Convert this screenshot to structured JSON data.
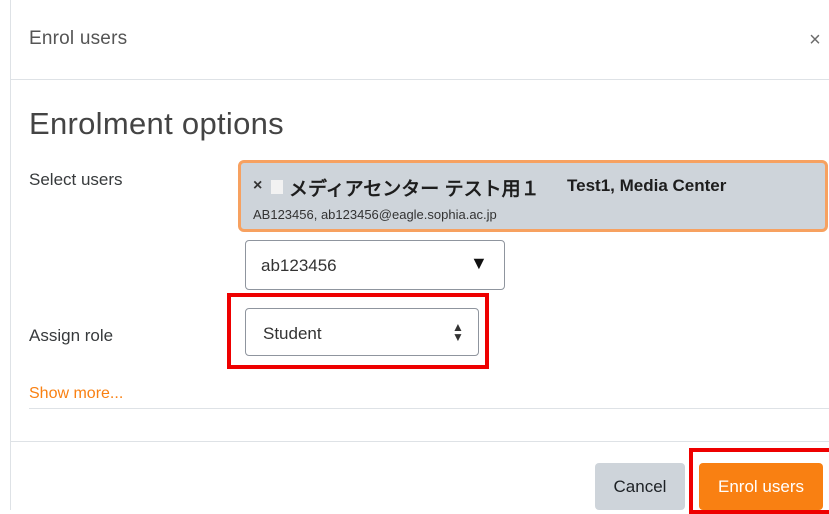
{
  "dialog": {
    "title": "Enrol users",
    "close_glyph": "×",
    "section_title": "Enrolment options"
  },
  "select_users": {
    "label": "Select users",
    "selected": {
      "remove_glyph": "×",
      "name": "メディアセンター テスト用１",
      "alt_name": "Test1, Media Center",
      "detail": "AB123456, ab123456@eagle.sophia.ac.jp"
    },
    "search": {
      "value": "ab123456",
      "arrow_glyph": "▼"
    }
  },
  "assign_role": {
    "label": "Assign role",
    "selected": "Student",
    "arrow_glyph": "⬍"
  },
  "show_more": "Show more...",
  "footer": {
    "cancel_label": "Cancel",
    "enrol_label": "Enrol users"
  },
  "colors": {
    "accent": "#f98012",
    "highlight": "#ee0000",
    "selected_bg": "#ced4da",
    "selected_border": "#f7a160"
  },
  "icons": {
    "close": "close-icon",
    "remove": "remove-icon",
    "dropdown": "chevron-down-icon",
    "select": "select-arrows-icon"
  }
}
